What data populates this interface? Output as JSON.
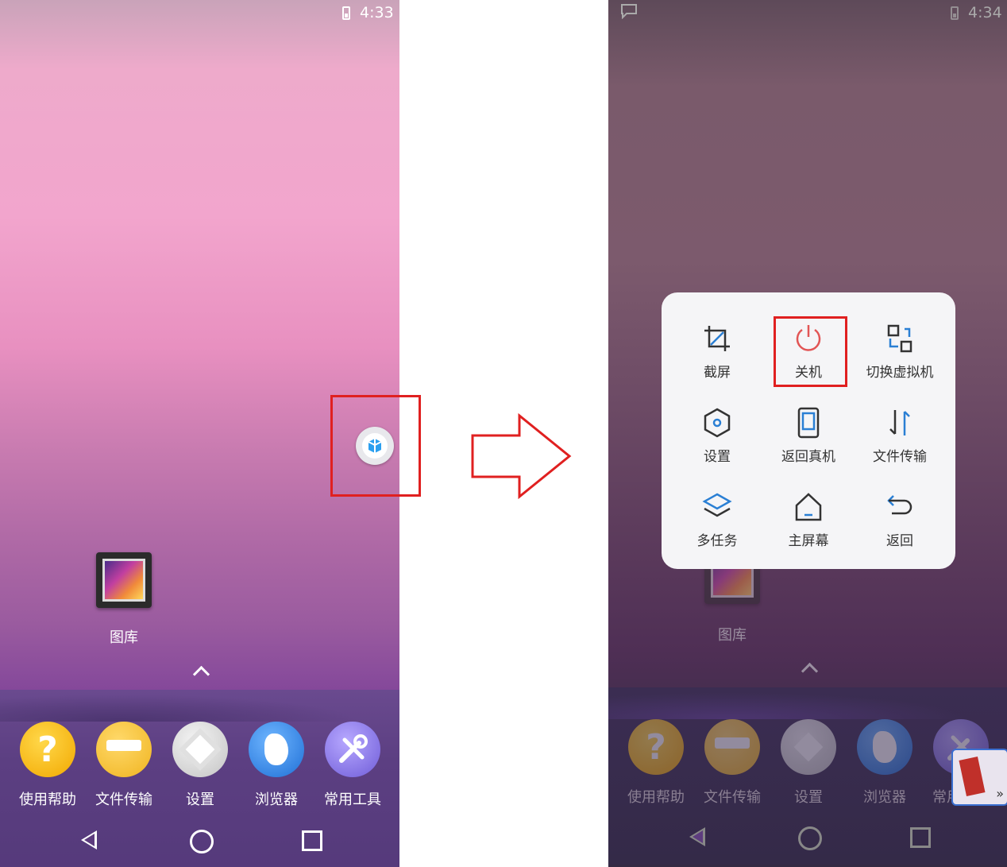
{
  "left_screen": {
    "status": {
      "time": "4:33"
    },
    "desktop_app": {
      "label": "图库"
    },
    "dock": [
      {
        "label": "使用帮助",
        "icon": "help-icon",
        "color": "#f7b500"
      },
      {
        "label": "文件传输",
        "icon": "file-transfer-icon",
        "color": "#f5c02a"
      },
      {
        "label": "设置",
        "icon": "settings-icon",
        "color": "#d8d8d8"
      },
      {
        "label": "浏览器",
        "icon": "browser-icon",
        "color": "#2a86e8"
      },
      {
        "label": "常用工具",
        "icon": "tools-icon",
        "color": "#8d7cf0"
      }
    ]
  },
  "right_screen": {
    "status": {
      "time": "4:34"
    },
    "desktop_app": {
      "label": "图库"
    },
    "dock": [
      {
        "label": "使用帮助"
      },
      {
        "label": "文件传输"
      },
      {
        "label": "设置"
      },
      {
        "label": "浏览器"
      },
      {
        "label": "常用工具"
      }
    ],
    "menu": {
      "items": [
        {
          "label": "截屏",
          "icon": "crop-icon"
        },
        {
          "label": "关机",
          "icon": "power-icon",
          "highlighted": true
        },
        {
          "label": "切换虚拟机",
          "icon": "switch-vm-icon"
        },
        {
          "label": "设置",
          "icon": "hexagon-settings-icon"
        },
        {
          "label": "返回真机",
          "icon": "phone-icon"
        },
        {
          "label": "文件传输",
          "icon": "transfer-arrows-icon"
        },
        {
          "label": "多任务",
          "icon": "layers-icon"
        },
        {
          "label": "主屏幕",
          "icon": "home-icon"
        },
        {
          "label": "返回",
          "icon": "return-icon"
        }
      ]
    }
  },
  "colors": {
    "highlight": "#e02020",
    "menu_icon": "#2a7fd4",
    "power_icon": "#e25555"
  }
}
